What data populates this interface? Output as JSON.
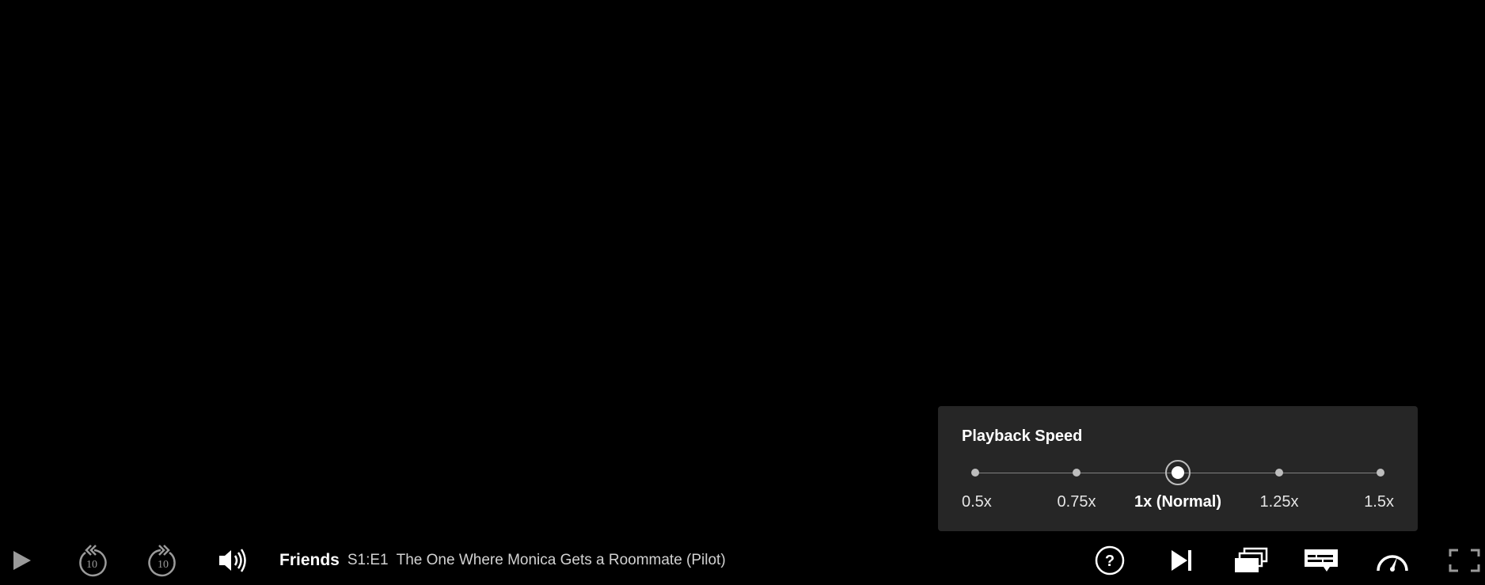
{
  "playback_speed": {
    "title": "Playback Speed",
    "options": [
      {
        "label": "0.5x"
      },
      {
        "label": "0.75x"
      },
      {
        "label": "1x (Normal)"
      },
      {
        "label": "1.25x"
      },
      {
        "label": "1.5x"
      }
    ],
    "selected_index": 2
  },
  "title_bar": {
    "show": "Friends",
    "episode_number": "S1:E1",
    "episode_title": "The One Where Monica Gets a Roommate (Pilot)"
  },
  "controls": {
    "left": [
      "play-icon",
      "rewind-10-icon",
      "forward-10-icon",
      "volume-icon"
    ],
    "right": [
      "help-icon",
      "next-episode-icon",
      "episodes-icon",
      "subtitles-icon",
      "playback-speed-icon",
      "fullscreen-icon"
    ],
    "skip_seconds": "10"
  },
  "colors": {
    "background": "#000000",
    "panel": "#262626",
    "icon": "#ffffff",
    "icon_dim": "#9a9a9a"
  }
}
